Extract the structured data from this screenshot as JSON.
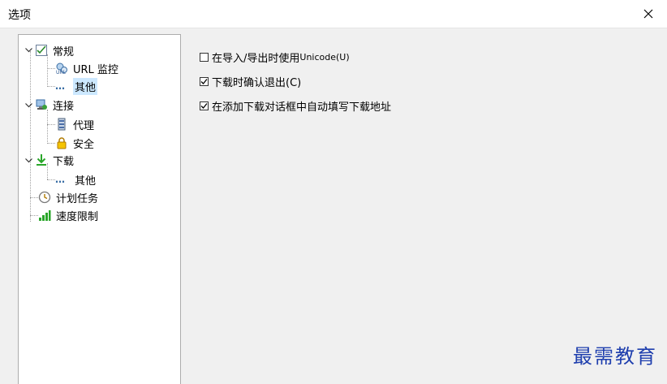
{
  "window": {
    "title": "选项"
  },
  "tree": {
    "general": {
      "label": "常规"
    },
    "url_monitor": {
      "label": "URL 监控"
    },
    "general_other": {
      "label": "其他"
    },
    "connection": {
      "label": "连接"
    },
    "proxy": {
      "label": "代理"
    },
    "security": {
      "label": "安全"
    },
    "download": {
      "label": "下载"
    },
    "download_other": {
      "label": "其他"
    },
    "scheduled": {
      "label": "计划任务"
    },
    "speed_limit": {
      "label": "速度限制"
    },
    "selected": "general_other"
  },
  "options": [
    {
      "prefix": "在导入/导出时使用 ",
      "suffix": "Unicode(U)",
      "checked": false
    },
    {
      "prefix": "下载时确认退出(C)",
      "suffix": "",
      "checked": true
    },
    {
      "prefix": "在添加下载对话框中自动填写下载地址",
      "suffix": "",
      "checked": true
    }
  ],
  "watermark": "最需教育",
  "colors": {
    "selection": "#cce8ff",
    "download_arrow": "#2aa62a",
    "watermark": "#1f3fae"
  }
}
